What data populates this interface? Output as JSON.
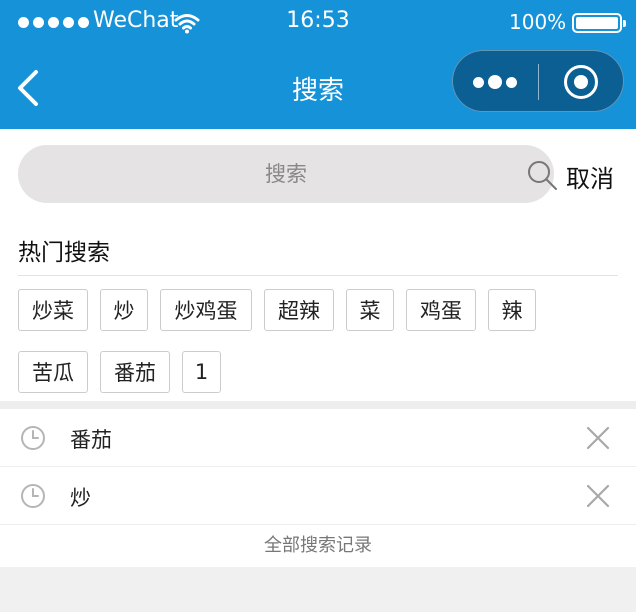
{
  "status_bar": {
    "carrier": "WeChat",
    "time": "16:53",
    "battery": "100%"
  },
  "nav": {
    "title": "搜索",
    "back_icon": "chevron-left-icon",
    "menu_icon": "more-dots-icon",
    "close_icon": "target-circle-icon"
  },
  "search": {
    "placeholder": "搜索",
    "value": "",
    "icon": "search-icon",
    "cancel_label": "取消"
  },
  "hot": {
    "title": "热门搜索",
    "tags": [
      "炒菜",
      "炒",
      "炒鸡蛋",
      "超辣",
      "菜",
      "鸡蛋",
      "辣",
      "苦瓜",
      "番茄",
      "1"
    ]
  },
  "history": {
    "items": [
      {
        "term": "番茄"
      },
      {
        "term": "炒"
      }
    ],
    "clock_icon": "clock-icon",
    "delete_icon": "close-icon",
    "all_label": "全部搜索记录"
  },
  "colors": {
    "nav_bg": "#1592d8",
    "capsule_bg": "#0b5f93",
    "search_bg": "#e5e3e4",
    "page_bg": "#f0f0f0"
  }
}
